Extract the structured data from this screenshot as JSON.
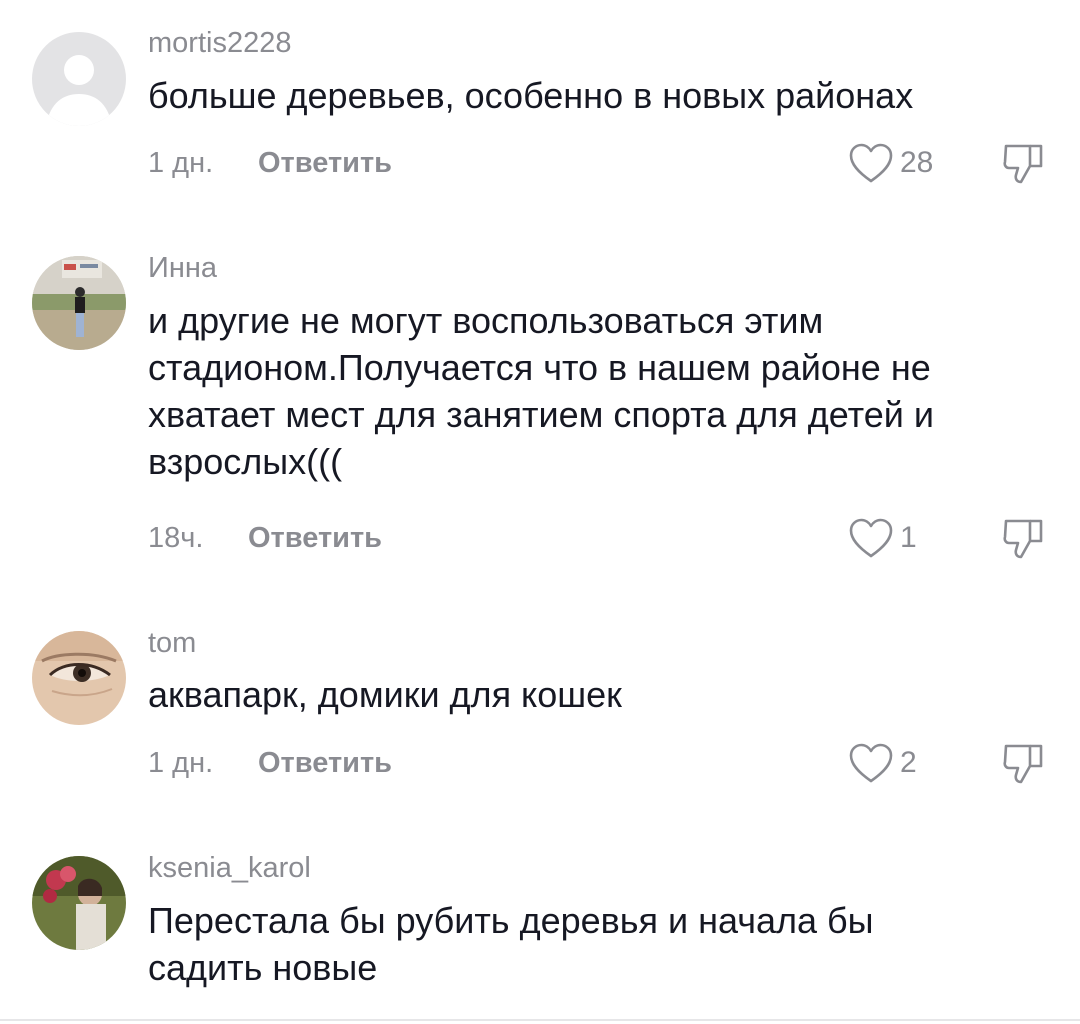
{
  "comments": [
    {
      "username": "mortis2228",
      "avatar": "default-avatar-icon",
      "text_lines": [
        "больше деревьев, особенно в новых районах"
      ],
      "time": "1 дн.",
      "reply_label": "Ответить",
      "likes": "28"
    },
    {
      "username": "Инна",
      "avatar": "photo-avatar-person-outdoors",
      "text_lines": [
        "и другие не могут воспользоваться этим",
        "стадионом.Получается что в нашем районе не",
        "хватает мест для занятием спорта для детей и",
        "взрослых((("
      ],
      "time": "18ч.",
      "reply_label": "Ответить",
      "likes": "1"
    },
    {
      "username": "tom",
      "avatar": "photo-avatar-eye-closeup",
      "text_lines": [
        "аквапарк, домики для кошек"
      ],
      "time": "1 дн.",
      "reply_label": "Ответить",
      "likes": "2"
    },
    {
      "username": "ksenia_karol",
      "avatar": "photo-avatar-girl-with-flowers",
      "text_lines": [
        "Перестала бы рубить деревья и начала бы",
        "садить новые"
      ]
    }
  ],
  "colors": {
    "text_primary": "#161823",
    "text_secondary": "#8a8b91",
    "background": "#ffffff"
  },
  "icons": {
    "like": "heart-outline-icon",
    "dislike": "thumbs-down-outline-icon"
  }
}
